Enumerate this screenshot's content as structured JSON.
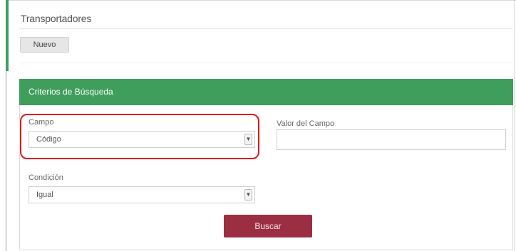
{
  "page": {
    "title": "Transportadores"
  },
  "toolbar": {
    "new_label": "Nuevo"
  },
  "search_panel": {
    "title": "Criterios de Búsqueda",
    "field": {
      "label": "Campo",
      "selected": "Código"
    },
    "field_value": {
      "label": "Valor del Campo",
      "value": ""
    },
    "condition": {
      "label": "Condición",
      "selected": "Igual"
    },
    "search_label": "Buscar"
  },
  "icons": {
    "select_caret": "chevron-down-icon"
  },
  "colors": {
    "accent_green": "#3f9e5c",
    "search_button": "#9b2e42",
    "highlight_red": "#e01818"
  }
}
